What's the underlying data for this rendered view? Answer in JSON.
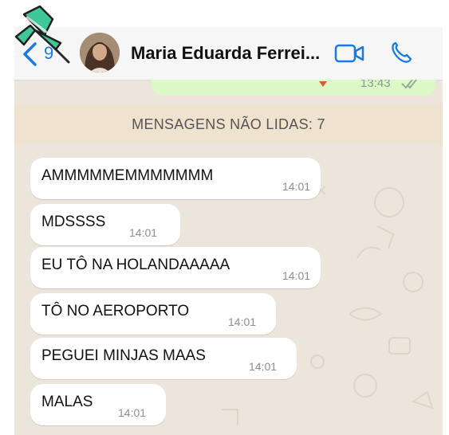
{
  "header": {
    "back_count": "9",
    "contact_name": "Maria Eduarda Ferrei...",
    "icons": [
      "back-chevron-icon",
      "video-call-icon",
      "phone-call-icon"
    ]
  },
  "previous_message": {
    "time": "13:43"
  },
  "unread_banner": "MENSAGENS NÃO LIDAS: 7",
  "messages": [
    {
      "text": "AMMMMMEMMMMMMM",
      "time": "14:01"
    },
    {
      "text": "MDSSSS",
      "time": "14:01"
    },
    {
      "text": "EU TÔ NA HOLANDAAAAA",
      "time": "14:01"
    },
    {
      "text": "TÔ NO AEROPORTO",
      "time": "14:01"
    },
    {
      "text": "PEGUEI MINJAS MAAS",
      "time": "14:01"
    },
    {
      "text": "MALAS",
      "time": "14:01"
    }
  ],
  "colors": {
    "accent": "#1b7ae0",
    "chat_background": "#ece5dc",
    "outgoing_bubble": "#dcf8c6",
    "unread_banner": "#efe3d0",
    "pin": "#3fc79a"
  }
}
